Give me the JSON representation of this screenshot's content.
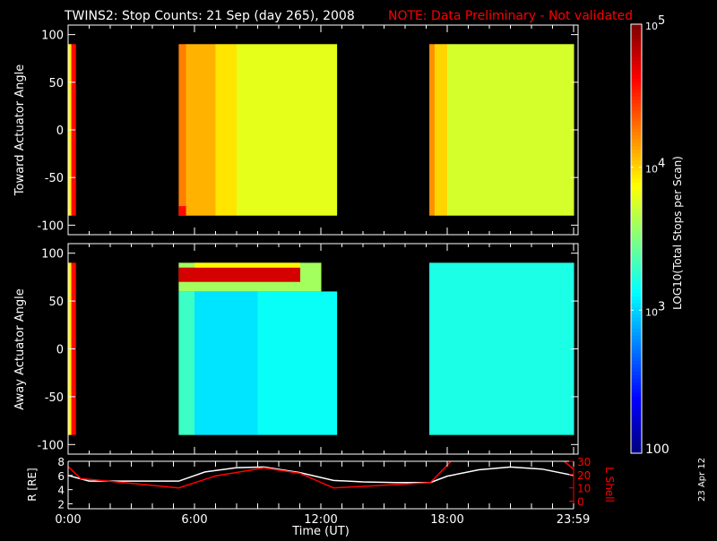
{
  "title": "TWINS2: Stop Counts: 21 Sep (day 265), 2008",
  "note": "NOTE: Data Preliminary - Not validated",
  "datestamp": "23 Apr 12",
  "colors": {
    "background": "#000000",
    "axes": "#ffffff",
    "note": "#ff0000",
    "r_line": "#ffffff",
    "lshell_line": "#ff0000"
  },
  "chart_data": [
    {
      "type": "heatmap",
      "name": "toward",
      "ylabel": "Toward Actuator Angle",
      "ylim": [
        -110,
        110
      ],
      "yticks": [
        100,
        50,
        0,
        -50,
        -100
      ],
      "ytick_labels": [
        "100",
        "50",
        "0",
        "-50",
        "-100"
      ],
      "xlim": [
        0,
        24
      ],
      "colorscale": "jet",
      "value_units": "log10 counts",
      "cells": [
        [
          0,
          0.15,
          -90,
          90,
          3.9
        ],
        [
          0.15,
          0.35,
          -90,
          90,
          4.6
        ],
        [
          5.25,
          5.6,
          -90,
          90,
          4.25
        ],
        [
          5.25,
          5.6,
          -90,
          -80,
          4.6
        ],
        [
          5.6,
          7,
          -90,
          90,
          4.1
        ],
        [
          7,
          8,
          -90,
          90,
          3.95
        ],
        [
          8,
          12.75,
          -90,
          90,
          3.8
        ],
        [
          17.15,
          17.4,
          -90,
          90,
          4.2
        ],
        [
          17.4,
          18,
          -90,
          90,
          4.0
        ],
        [
          18,
          24,
          -90,
          90,
          3.75
        ]
      ]
    },
    {
      "type": "heatmap",
      "name": "away",
      "ylabel": "Away Actuator Angle",
      "ylim": [
        -110,
        110
      ],
      "yticks": [
        100,
        50,
        0,
        -50,
        -100
      ],
      "ytick_labels": [
        "100",
        "50",
        "0",
        "-50",
        "-100"
      ],
      "xlim": [
        0,
        24
      ],
      "colorscale": "jet",
      "value_units": "log10 counts",
      "cells": [
        [
          0,
          0.15,
          -90,
          90,
          3.9
        ],
        [
          0.15,
          0.35,
          -90,
          90,
          4.6
        ],
        [
          5.25,
          6,
          -90,
          60,
          3.3
        ],
        [
          6,
          9,
          -90,
          60,
          3.05
        ],
        [
          9,
          12.75,
          -90,
          60,
          3.15
        ],
        [
          5.25,
          12,
          60,
          90,
          3.6
        ],
        [
          5.25,
          11,
          70,
          85,
          4.75
        ],
        [
          6,
          11,
          85,
          90,
          3.9
        ],
        [
          17.15,
          24,
          -90,
          90,
          3.2
        ]
      ]
    },
    {
      "type": "colorbar",
      "label": "LOG10(Total Stops per Scan)",
      "range": [
        100,
        100000
      ],
      "scale": "log",
      "tick_labels": [
        "100",
        "10^3",
        "10^4",
        "10^5"
      ]
    },
    {
      "type": "line",
      "xlabel": "Time (UT)",
      "xlim": [
        0,
        24
      ],
      "xtick_labels": [
        "0:00",
        "6:00",
        "12:00",
        "18:00",
        "23:59"
      ],
      "xticks": [
        0,
        6,
        12,
        18,
        23.98
      ],
      "ylabel": "R [RE]",
      "ylim": [
        1.3,
        8
      ],
      "yticks": [
        2,
        4,
        6,
        8
      ],
      "y2label": "L Shell",
      "y2lim": [
        -5.7,
        30
      ],
      "y2ticks": [
        0,
        10,
        20,
        30
      ],
      "series": [
        {
          "name": "R [RE]",
          "axis": "left",
          "x": [
            0,
            1,
            5.25,
            6.5,
            8,
            9.3,
            11,
            12.6,
            14,
            15.5,
            17.2,
            18,
            19.5,
            21,
            22.5,
            24
          ],
          "y": [
            6.0,
            5.2,
            5.2,
            6.5,
            7.1,
            7.2,
            6.4,
            5.3,
            5.1,
            5.0,
            5.0,
            5.9,
            6.8,
            7.2,
            6.9,
            6.0
          ]
        },
        {
          "name": "L Shell",
          "axis": "right",
          "x": [
            0,
            0.6,
            5.25,
            7,
            9.3,
            11,
            12.6,
            15,
            17.2,
            18.3
          ],
          "y": [
            26,
            17,
            10,
            19,
            25,
            21,
            10,
            12,
            14,
            32
          ]
        },
        {
          "name": "L Shell",
          "axis": "right",
          "x": [
            23.4,
            24
          ],
          "y": [
            32,
            24
          ]
        }
      ]
    }
  ]
}
